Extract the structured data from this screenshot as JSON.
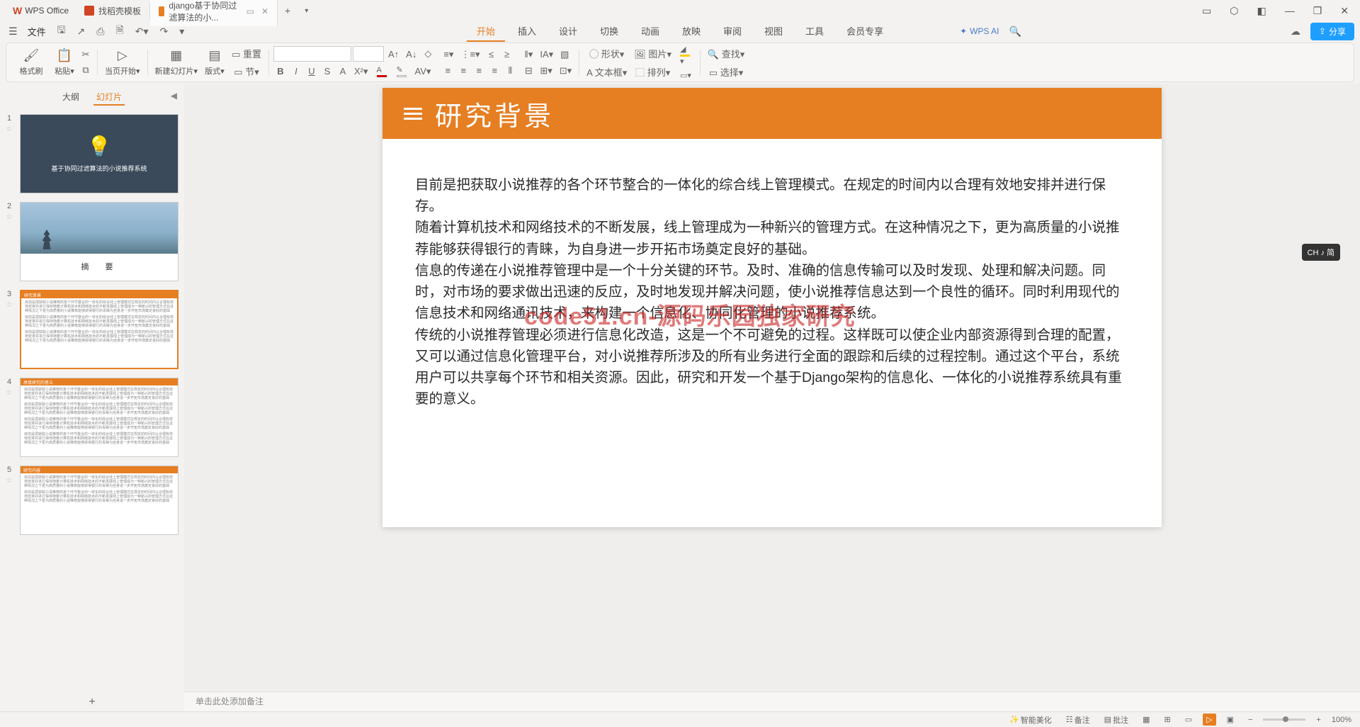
{
  "tabs": {
    "home": "WPS Office",
    "template": "找稻壳模板",
    "doc": "django基于协同过滤算法的小...",
    "add": "+"
  },
  "menu": {
    "file": "文件",
    "tabs": [
      "开始",
      "插入",
      "设计",
      "切换",
      "动画",
      "放映",
      "审阅",
      "视图",
      "工具",
      "会员专享"
    ],
    "wps_ai": "WPS AI",
    "share": "分享"
  },
  "ribbon": {
    "format_painter": "格式刷",
    "paste": "粘贴",
    "start_current": "当页开始",
    "new_slide": "新建幻灯片",
    "layout": "版式",
    "section": "节",
    "reset": "重置",
    "shape": "形状",
    "image": "图片",
    "textbox": "文本框",
    "arrange": "排列",
    "find": "查找",
    "select": "选择"
  },
  "panel": {
    "outline": "大纲",
    "slides": "幻灯片",
    "s1_title": "基于协同过滤算法的小说推荐系统",
    "s2_title": "摘　要",
    "s3_head": "研究背景",
    "s4_head": "承接研究的意义",
    "s5_head": "研究内容"
  },
  "slide": {
    "title": "研究背景",
    "p1": "目前是把获取小说推荐的各个环节整合的一体化的综合线上管理模式。在规定的时间内以合理有效地安排并进行保存。",
    "p2": "随着计算机技术和网络技术的不断发展，线上管理成为一种新兴的管理方式。在这种情况之下，更为高质量的小说推荐能够获得银行的青睐，为自身进一步开拓市场奠定良好的基础。",
    "p3": "信息的传递在小说推荐管理中是一个十分关键的环节。及时、准确的信息传输可以及时发现、处理和解决问题。同时，对市场的要求做出迅速的反应，及时地发现并解决问题，使小说推荐信息达到一个良性的循环。同时利用现代的信息技术和网络通讯技术，来构建一个信息化、协同化管理的小说推荐系统。",
    "p4": "传统的小说推荐管理必须进行信息化改造，这是一个不可避免的过程。这样既可以使企业内部资源得到合理的配置，又可以通过信息化管理平台，对小说推荐所涉及的所有业务进行全面的跟踪和后续的过程控制。通过这个平台，系统用户可以共享每个环节和相关资源。因此，研究和开发一个基于Django架构的信息化、一体化的小说推荐系统具有重要的意义。"
  },
  "watermark": "code51.cn-源码乐园独家研究",
  "notes": "单击此处添加备注",
  "ime": "CH ♪ 简",
  "status": {
    "smart": "智能美化",
    "notes_btn": "备注",
    "comment": "批注",
    "zoom": "100%"
  },
  "thumbs": {
    "filler": "目前是把获取小说推荐的各个环节整合的一体化的综合线上管理模式在规定的时间内以合理有效地安排并进行保存随着计算机技术和网络技术的不断发展线上管理成为一种新兴的管理方式在这种情况之下更为高质量的小说推荐能够获得银行的青睐为自身进一步开拓市场奠定良好的基础"
  }
}
